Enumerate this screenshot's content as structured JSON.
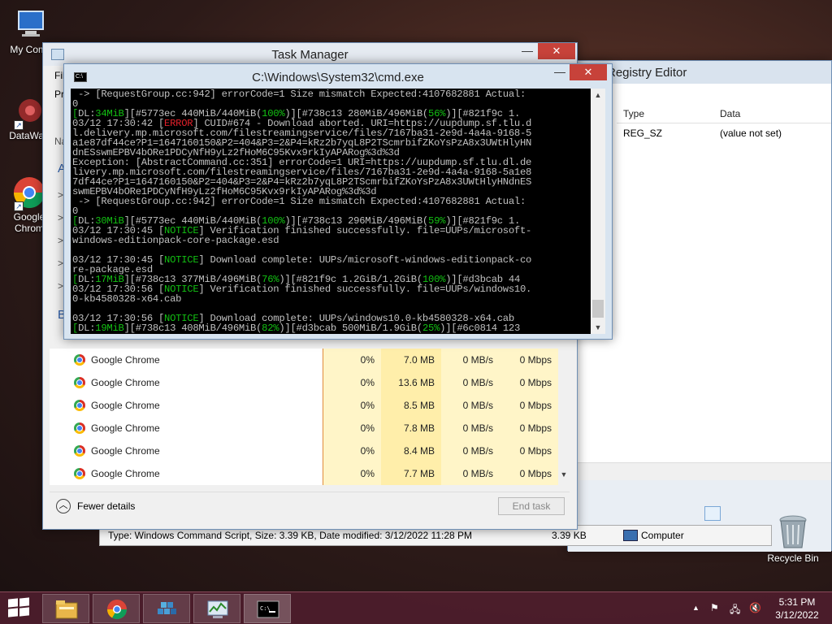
{
  "desktop": {
    "icons": [
      {
        "label": "My Comp"
      },
      {
        "label": "DataWag"
      },
      {
        "label": "Google Chrom"
      }
    ],
    "recycle_bin": "Recycle Bin"
  },
  "registry_editor": {
    "title": "Registry Editor",
    "col_type": "Type",
    "col_data": "Data",
    "row_type": "REG_SZ",
    "row_data": "(value not set)"
  },
  "explorer_status": {
    "type_text": "Type: Windows Command Script, Size: 3.39 KB, Date modified: 3/12/2022 11:28 PM",
    "size": "3.39 KB",
    "location": "Computer"
  },
  "task_manager": {
    "title": "Task Manager",
    "menu_file": "Fil",
    "tab_partial": "Pr",
    "side_letters": [
      "Na",
      "A",
      ">",
      ">",
      ">",
      ">",
      ">",
      "B"
    ],
    "rows": [
      {
        "name": "Google Chrome",
        "cpu": "0%",
        "memory": "7.0 MB",
        "disk": "0 MB/s",
        "network": "0 Mbps"
      },
      {
        "name": "Google Chrome",
        "cpu": "0%",
        "memory": "13.6 MB",
        "disk": "0 MB/s",
        "network": "0 Mbps"
      },
      {
        "name": "Google Chrome",
        "cpu": "0%",
        "memory": "8.5 MB",
        "disk": "0 MB/s",
        "network": "0 Mbps"
      },
      {
        "name": "Google Chrome",
        "cpu": "0%",
        "memory": "7.8 MB",
        "disk": "0 MB/s",
        "network": "0 Mbps"
      },
      {
        "name": "Google Chrome",
        "cpu": "0%",
        "memory": "8.4 MB",
        "disk": "0 MB/s",
        "network": "0 Mbps"
      },
      {
        "name": "Google Chrome",
        "cpu": "0%",
        "memory": "7.7 MB",
        "disk": "0 MB/s",
        "network": "0 Mbps"
      }
    ],
    "fewer_details": "Fewer details",
    "end_task": "End task"
  },
  "cmd": {
    "title": "C:\\Windows\\System32\\cmd.exe",
    "lines": [
      [
        {
          "t": " -> [RequestGroup.cc:942] errorCode=1 Size mismatch Expected:4107682881 Actual:",
          "c": ""
        }
      ],
      [
        {
          "t": "0",
          "c": ""
        }
      ],
      [
        {
          "t": "[",
          "c": "g"
        },
        {
          "t": "DL:",
          "c": ""
        },
        {
          "t": "34MiB",
          "c": "g"
        },
        {
          "t": "][#5773ec 440MiB/440MiB(",
          "c": ""
        },
        {
          "t": "100%",
          "c": "g"
        },
        {
          "t": ")][#738c13 280MiB/496MiB(",
          "c": ""
        },
        {
          "t": "56%",
          "c": "g"
        },
        {
          "t": ")][#821f9c 1.",
          "c": ""
        }
      ],
      [
        {
          "t": "03/12 17:30:42 [",
          "c": ""
        },
        {
          "t": "ERROR",
          "c": "r"
        },
        {
          "t": "] CUID#674 - Download aborted. URI=https://uupdump.sf.tlu.d",
          "c": ""
        }
      ],
      [
        {
          "t": "l.delivery.mp.microsoft.com/filestreamingservice/files/7167ba31-2e9d-4a4a-9168-5",
          "c": ""
        }
      ],
      [
        {
          "t": "a1e87df44ce?P1=1647160150&P2=404&P3=2&P4=kRz2b7yqL8P2TScmrbifZKoYsPzA8x3UWtHlyHN",
          "c": ""
        }
      ],
      [
        {
          "t": "dnESswmEPBV4bORe1PDCyNfH9yLz2fHoM6C95Kvx9rkIyAPARog%3d%3d",
          "c": ""
        }
      ],
      [
        {
          "t": "Exception: [AbstractCommand.cc:351] errorCode=1 URI=https://uupdump.sf.tlu.dl.de",
          "c": ""
        }
      ],
      [
        {
          "t": "livery.mp.microsoft.com/filestreamingservice/files/7167ba31-2e9d-4a4a-9168-5a1e8",
          "c": ""
        }
      ],
      [
        {
          "t": "7df44ce?P1=1647160150&P2=404&P3=2&P4=kRz2b7yqL8P2TScmrbifZKoYsPzA8x3UWtHlyHNdnES",
          "c": ""
        }
      ],
      [
        {
          "t": "swmEPBV4bORe1PDCyNfH9yLz2fHoM6C95Kvx9rkIyAPARog%3d%3d",
          "c": ""
        }
      ],
      [
        {
          "t": " -> [RequestGroup.cc:942] errorCode=1 Size mismatch Expected:4107682881 Actual:",
          "c": ""
        }
      ],
      [
        {
          "t": "0",
          "c": ""
        }
      ],
      [
        {
          "t": "[",
          "c": "g"
        },
        {
          "t": "DL:",
          "c": ""
        },
        {
          "t": "30MiB",
          "c": "g"
        },
        {
          "t": "][#5773ec 440MiB/440MiB(",
          "c": ""
        },
        {
          "t": "100%",
          "c": "g"
        },
        {
          "t": ")][#738c13 296MiB/496MiB(",
          "c": ""
        },
        {
          "t": "59%",
          "c": "g"
        },
        {
          "t": ")][#821f9c 1.",
          "c": ""
        }
      ],
      [
        {
          "t": "03/12 17:30:45 [",
          "c": ""
        },
        {
          "t": "NOTICE",
          "c": "g"
        },
        {
          "t": "] Verification finished successfully. file=UUPs/microsoft-",
          "c": ""
        }
      ],
      [
        {
          "t": "windows-editionpack-core-package.esd",
          "c": ""
        }
      ],
      [
        {
          "t": "",
          "c": ""
        }
      ],
      [
        {
          "t": "03/12 17:30:45 [",
          "c": ""
        },
        {
          "t": "NOTICE",
          "c": "g"
        },
        {
          "t": "] Download complete: UUPs/microsoft-windows-editionpack-co",
          "c": ""
        }
      ],
      [
        {
          "t": "re-package.esd",
          "c": ""
        }
      ],
      [
        {
          "t": "[",
          "c": "g"
        },
        {
          "t": "DL:",
          "c": ""
        },
        {
          "t": "17MiB",
          "c": "g"
        },
        {
          "t": "][#738c13 377MiB/496MiB(",
          "c": ""
        },
        {
          "t": "76%",
          "c": "g"
        },
        {
          "t": ")][#821f9c 1.2GiB/1.2GiB(",
          "c": ""
        },
        {
          "t": "100%",
          "c": "g"
        },
        {
          "t": ")][#d3bcab 44",
          "c": ""
        }
      ],
      [
        {
          "t": "03/12 17:30:56 [",
          "c": ""
        },
        {
          "t": "NOTICE",
          "c": "g"
        },
        {
          "t": "] Verification finished successfully. file=UUPs/windows10.",
          "c": ""
        }
      ],
      [
        {
          "t": "0-kb4580328-x64.cab",
          "c": ""
        }
      ],
      [
        {
          "t": "",
          "c": ""
        }
      ],
      [
        {
          "t": "03/12 17:30:56 [",
          "c": ""
        },
        {
          "t": "NOTICE",
          "c": "g"
        },
        {
          "t": "] Download complete: UUPs/windows10.0-kb4580328-x64.cab",
          "c": ""
        }
      ],
      [
        {
          "t": "[",
          "c": "g"
        },
        {
          "t": "DL:",
          "c": ""
        },
        {
          "t": "19MiB",
          "c": "g"
        },
        {
          "t": "][#738c13 408MiB/496MiB(",
          "c": ""
        },
        {
          "t": "82%",
          "c": "g"
        },
        {
          "t": ")][#d3bcab 500MiB/1.9GiB(",
          "c": ""
        },
        {
          "t": "25%",
          "c": "g"
        },
        {
          "t": ")][#6c0814 123",
          "c": ""
        }
      ]
    ]
  },
  "taskbar": {
    "time": "5:31 PM",
    "date": "3/12/2022"
  },
  "colors": {
    "console_green": "#13c113",
    "console_red": "#e0202a",
    "close_button": "#c7423a",
    "taskbar": "#50202d"
  }
}
